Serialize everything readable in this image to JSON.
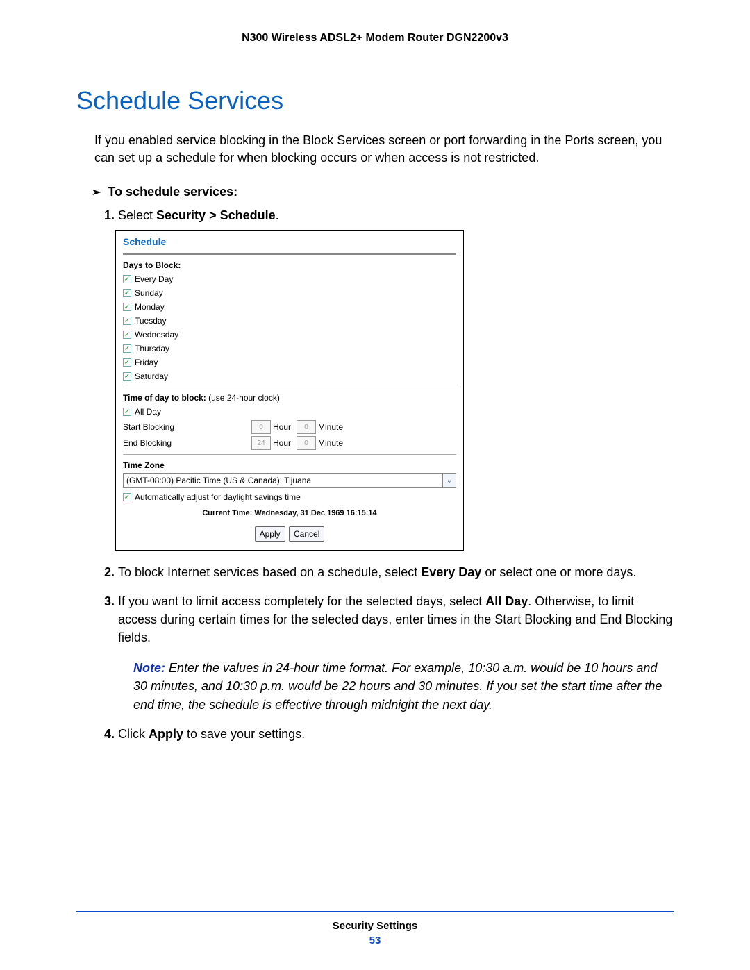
{
  "header": {
    "product": "N300 Wireless ADSL2+ Modem Router DGN2200v3"
  },
  "section": {
    "title": "Schedule Services",
    "intro": "If you enabled service blocking in the Block Services screen or port forwarding in the Ports screen, you can set up a schedule for when blocking occurs or when access is not restricted."
  },
  "task": {
    "label": "To schedule services:"
  },
  "steps": {
    "s1_pre": "Select ",
    "s1_bold": "Security > Schedule",
    "s1_post": ".",
    "s2_pre": "To block Internet services based on a schedule, select ",
    "s2_bold": "Every Day",
    "s2_post": " or select one or more days.",
    "s3_pre": "If you want to limit access completely for the selected days, select ",
    "s3_bold": "All Day",
    "s3_post": ". Otherwise, to limit access during certain times for the selected days, enter times in the Start Blocking and End Blocking fields.",
    "s4_pre": "Click ",
    "s4_bold": "Apply",
    "s4_post": " to save your settings."
  },
  "note": {
    "label": "Note: ",
    "text": " Enter the values in 24-hour time format. For example, 10:30 a.m. would be 10 hours and 30 minutes, and 10:30 p.m. would be 22 hours and 30 minutes. If you set the start time after the end time, the schedule is effective through midnight the next day."
  },
  "screenshot": {
    "title": "Schedule",
    "days_label": "Days to Block:",
    "days": [
      "Every Day",
      "Sunday",
      "Monday",
      "Tuesday",
      "Wednesday",
      "Thursday",
      "Friday",
      "Saturday"
    ],
    "time_label": "Time of day to block: ",
    "time_hint": "(use 24-hour clock)",
    "all_day": "All Day",
    "start_label": "Start Blocking",
    "end_label": "End Blocking",
    "start_hour": "0",
    "start_min": "0",
    "end_hour": "24",
    "end_min": "0",
    "hour_unit": "Hour",
    "min_unit": "Minute",
    "tz_label": "Time Zone",
    "tz_value": "(GMT-08:00) Pacific Time (US & Canada); Tijuana",
    "dst": "Automatically adjust for daylight savings time",
    "current_time": "Current Time: Wednesday, 31 Dec 1969 16:15:14",
    "apply": "Apply",
    "cancel": "Cancel"
  },
  "footer": {
    "title": "Security Settings",
    "page": "53"
  }
}
